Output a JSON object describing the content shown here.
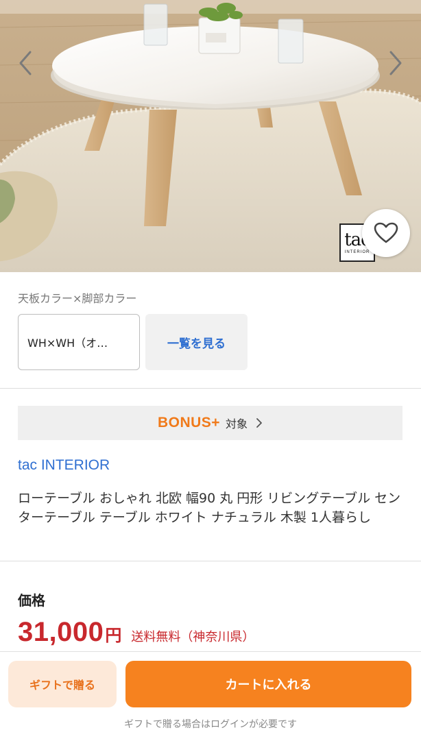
{
  "product_image": {
    "brand_logo_main": "tac",
    "brand_logo_sub": "INTERIOR",
    "prev_icon": "chevron-left-icon",
    "next_icon": "chevron-right-icon",
    "favorite_icon": "heart-outline-icon"
  },
  "variant": {
    "label": "天板カラー×脚部カラー",
    "selected_value": "WH×WH（オ…",
    "view_all_label": "一覧を見る"
  },
  "bonus": {
    "logo": "BONUS+",
    "text": "対象",
    "icon": "chevron-right-icon"
  },
  "shop": {
    "name": "tac INTERIOR"
  },
  "product": {
    "title": "ローテーブル おしゃれ 北欧 幅90 丸 円形 リビングテーブル センターテーブル テーブル ホワイト ナチュラル 木製 1人暮らし"
  },
  "price": {
    "label": "価格",
    "value": "31,000",
    "unit": "円",
    "shipping": "送料無料（神奈川県）"
  },
  "actions": {
    "gift_label": "ギフトで贈る",
    "cart_label": "カートに入れる",
    "gift_note": "ギフトで贈る場合はログインが必要です"
  },
  "colors": {
    "accent_orange": "#f6821f",
    "price_red": "#c8282d",
    "link_blue": "#2f6fd1"
  }
}
